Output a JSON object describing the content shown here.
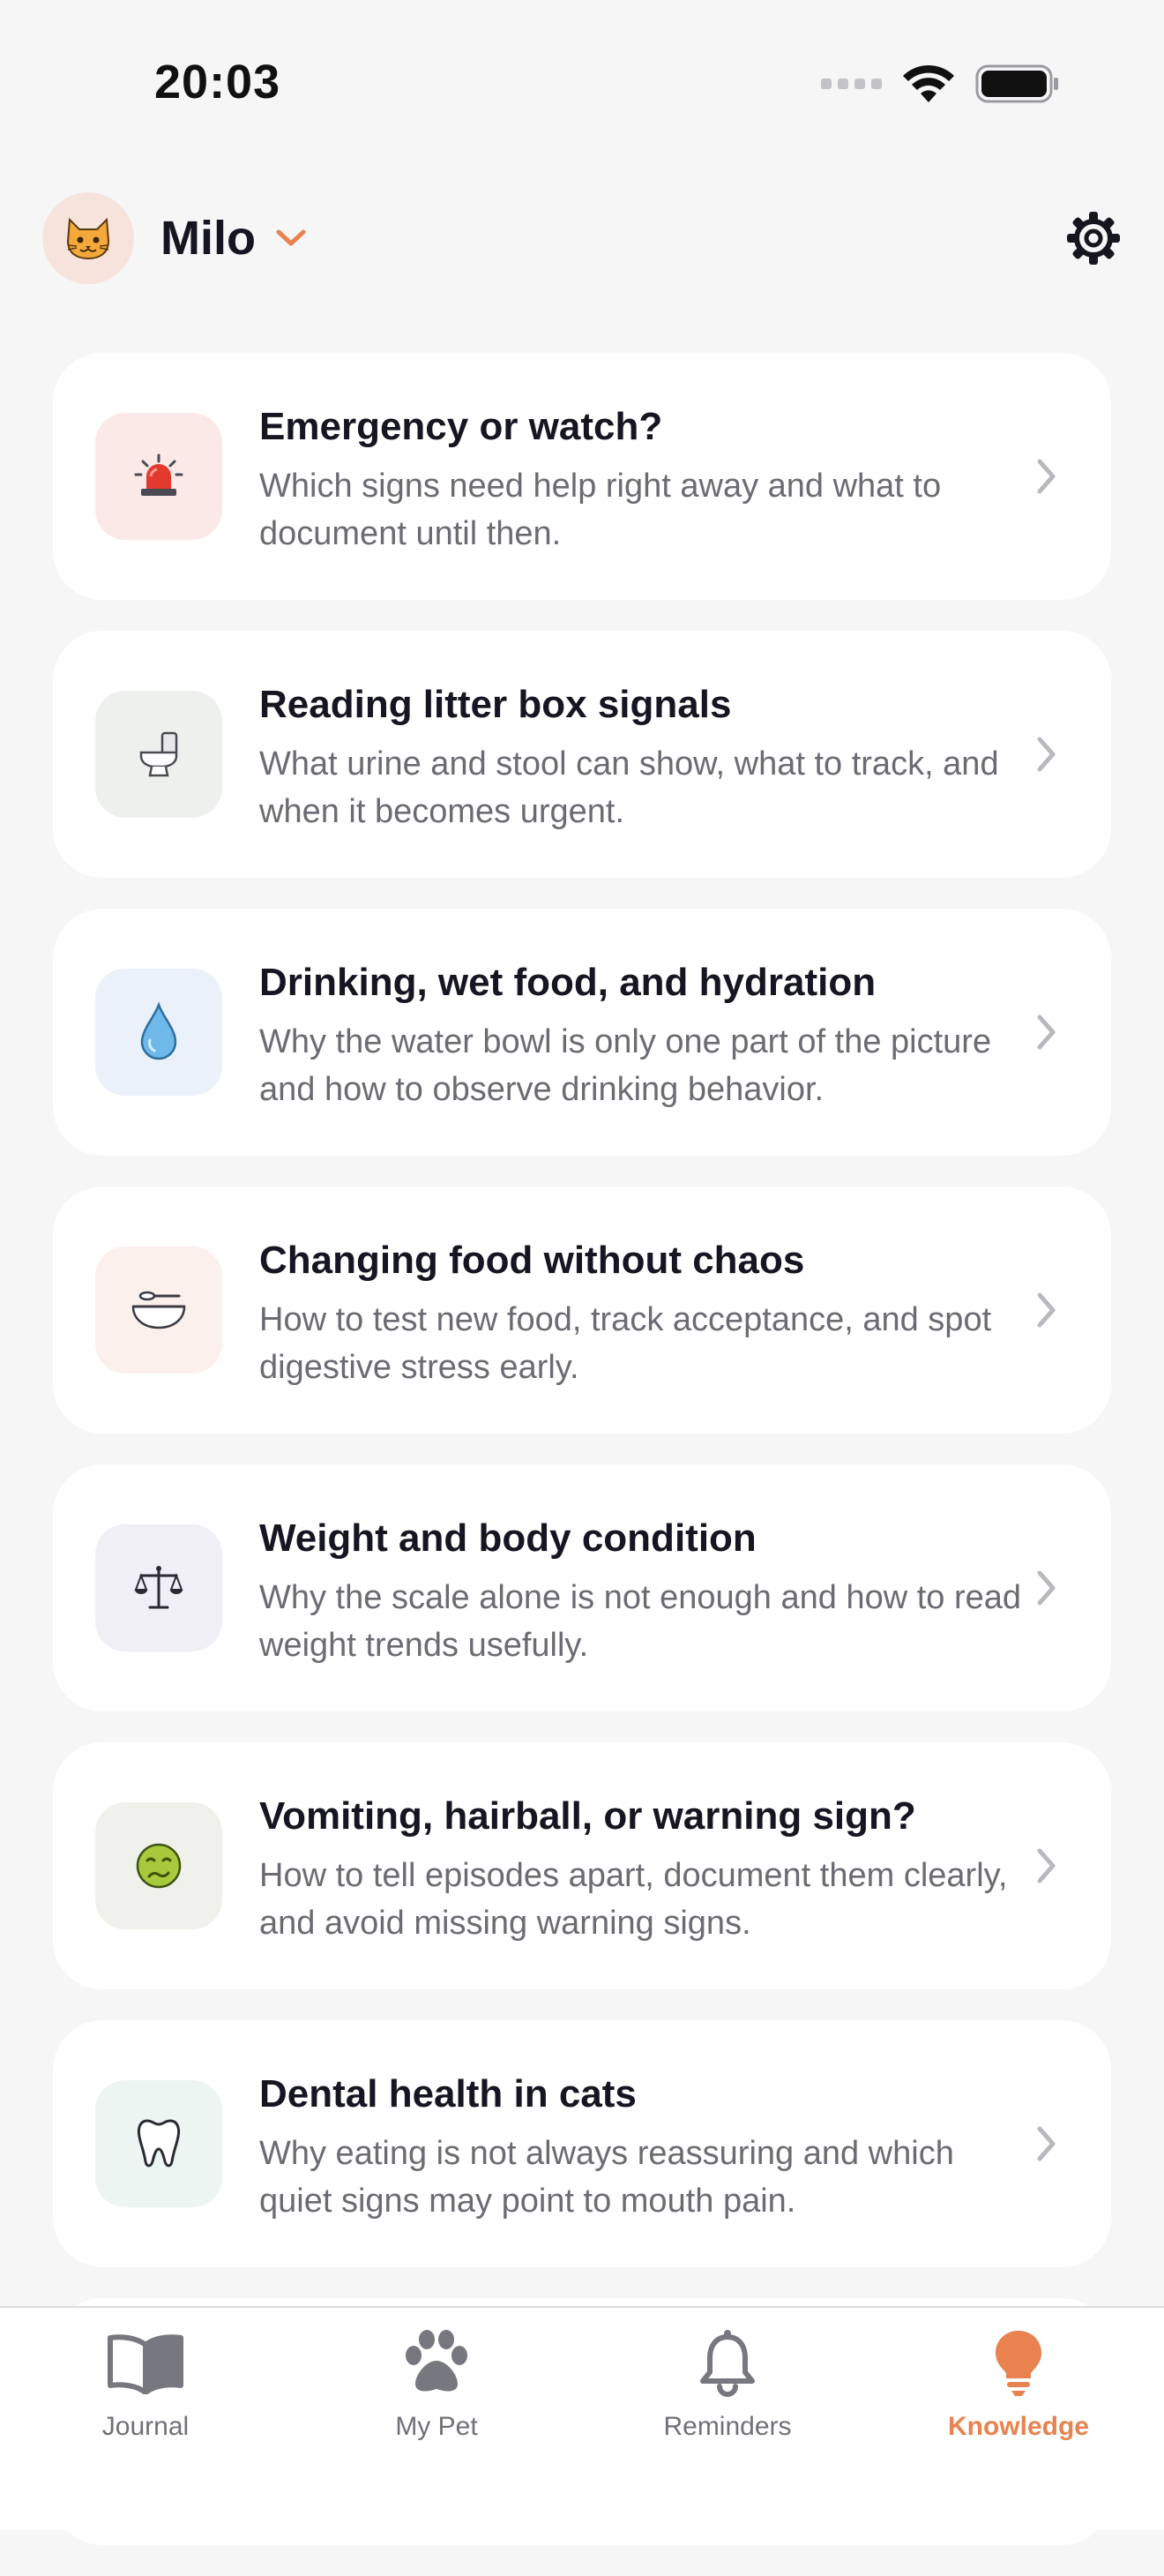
{
  "status_bar": {
    "time": "20:03"
  },
  "header": {
    "pet_name": "Milo",
    "avatar_icon": "cat-face-icon",
    "dropdown_icon": "chevron-down-icon",
    "settings_icon": "gear-icon"
  },
  "colors": {
    "accent": "#e8834f",
    "background": "#f6f6f7",
    "card": "#ffffff",
    "text_primary": "#161622",
    "text_secondary": "#6b6b73"
  },
  "articles": [
    {
      "title": "Emergency or watch?",
      "description": "Which signs need help right away and what to document until then.",
      "icon": "siren-icon",
      "icon_bg": "#fbe9e7"
    },
    {
      "title": "Reading litter box signals",
      "description": "What urine and stool can show, what to track, and when it becomes urgent.",
      "icon": "toilet-icon",
      "icon_bg": "#eef0ee"
    },
    {
      "title": "Drinking, wet food, and hydration",
      "description": "Why the water bowl is only one part of the picture and how to observe drinking behavior.",
      "icon": "water-drop-icon",
      "icon_bg": "#eaf1fb"
    },
    {
      "title": "Changing food without chaos",
      "description": "How to test new food, track acceptance, and spot digestive stress early.",
      "icon": "food-bowl-icon",
      "icon_bg": "#fcf0ec"
    },
    {
      "title": "Weight and body condition",
      "description": "Why the scale alone is not enough and how to read weight trends usefully.",
      "icon": "scale-icon",
      "icon_bg": "#f0eff5"
    },
    {
      "title": "Vomiting, hairball, or warning sign?",
      "description": "How to tell episodes apart, document them clearly, and avoid missing warning signs.",
      "icon": "nauseated-face-icon",
      "icon_bg": "#f0f1ea"
    },
    {
      "title": "Dental health in cats",
      "description": "Why eating is not always reassuring and which quiet signs may point to mouth pain.",
      "icon": "tooth-icon",
      "icon_bg": "#ecf5f2"
    }
  ],
  "tabs": [
    {
      "label": "Journal",
      "icon": "book-icon",
      "active": false
    },
    {
      "label": "My Pet",
      "icon": "paw-icon",
      "active": false
    },
    {
      "label": "Reminders",
      "icon": "bell-icon",
      "active": false
    },
    {
      "label": "Knowledge",
      "icon": "lightbulb-icon",
      "active": true
    }
  ]
}
